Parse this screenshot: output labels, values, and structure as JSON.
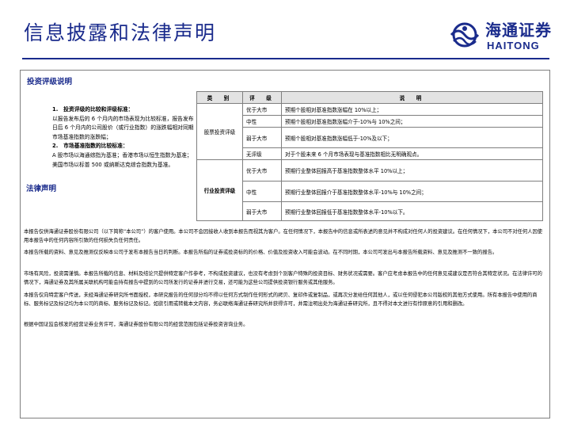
{
  "header": {
    "title": "信息披露和法律声明",
    "logo_cn": "海通证券",
    "logo_en": "HAITONG"
  },
  "rating_section": {
    "heading": "投资评级说明",
    "definitions": {
      "item1_title": "1.　投资评级的比较和评级标准：",
      "item1_body": "以报告发布后的 6 个月内的市场表现为比较标准，报告发布日后 6 个月内的公司股价（或行业指数）的涨跌幅相对同期市场基准指数的涨跌幅；",
      "item2_title": "2.　市场基准指数的比较标准：",
      "item2_body": "A 股市场以海通综指为基准；香港市场以恒生指数为基准；美国市场以标普 500 或纳斯达克综合指数为基准。"
    },
    "table": {
      "headers": [
        "类　别",
        "评　级",
        "说　明"
      ],
      "stock_category": "股票投资评级",
      "industry_category": "行业投资评级",
      "stock_rows": [
        {
          "level": "优于大市",
          "desc": "预期个股相对基准指数涨幅在 10%以上；"
        },
        {
          "level": "中性",
          "desc": "预期个股相对基准指数涨幅介于-10%与 10%之间；"
        },
        {
          "level": "弱于大市",
          "desc": "预期个股相对基准指数涨幅低于-10%及以下；"
        },
        {
          "level": "无评级",
          "desc": "对于个股未来 6 个月市场表现与基准指数相比无明确观点。"
        }
      ],
      "industry_rows": [
        {
          "level": "优于大市",
          "desc": "预期行业整体回报高于基准指数整体水平 10%以上；"
        },
        {
          "level": "中性",
          "desc": "预期行业整体回报介于基准指数整体水平-10%与 10%之间；"
        },
        {
          "level": "弱于大市",
          "desc": "预期行业整体回报低于基准指数整体水平-10%以下。"
        }
      ]
    }
  },
  "legal_section": {
    "heading": "法律声明",
    "paragraphs": [
      "本报告仅供海通证券股份有限公司（以下简称“本公司”）的客户使用。本公司不会因接收人收到本报告而视其为客户。在任何情况下，本报告中的信息或所表述的意见并不构成对任何人的投资建议。在任何情况下，本公司不对任何人因使用本报告中的任何内容所引致的任何损失负任何责任。",
      "本报告所载的资料、意见及推测仅反映本公司于发布本报告当日的判断。本报告所指的证券或投资标的的价格、价值及投资收入可能会波动。在不同时期，本公司可发出与本报告所载资料、意见及推测不一致的报告。",
      "市场有风险，投资需谨慎。本报告所载的信息、材料及结论只提供特定客户作参考，不构成投资建议，也没有考虑到个别客户特殊的投资目标、财务状况或需要。客户应考虑本报告中的任何意见或建议是否符合其特定状况。在法律许可的情况下，海通证券及其所属关联机构可能会持有报告中提到的公司所发行的证券并进行交易，还可能为这些公司提供投资银行服务或其他服务。",
      "本报告仅向特定客户传送，未经海通证券研究所书面授权，本研究报告的任何部分均不得以任何方式制作任何形式的拷贝、复印件或复制品，或再次分发给任何其他人，或以任何侵犯本公司版权的其他方式使用。所有本报告中使用的商标、服务标记及标记均为本公司的商标、服务标记及标记。如欲引用或转载本文内容，务必联络海通证券研究所并获得许可，并需注明出处为海通证券研究所，且不得对本文进行有悖原意的引用和删改。",
      "根据中国证监会核发的经营证券业务许可，海通证券股份有限公司的经营范围包括证券投资咨询业务。"
    ]
  },
  "colors": {
    "brand_blue": "#1a2b8c",
    "header_gray": "#e3e3e3",
    "border_gray": "#7f7f7f"
  }
}
